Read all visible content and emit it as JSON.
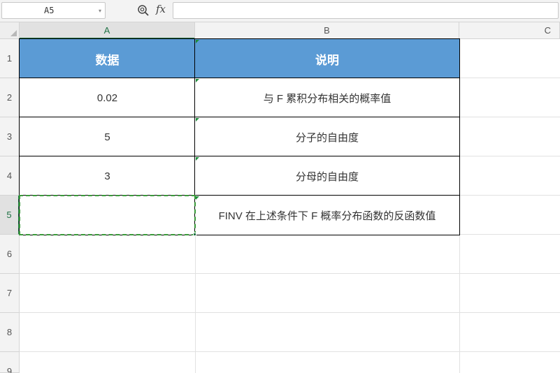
{
  "formula_bar": {
    "name_box_value": "A5",
    "fx_label": "fx",
    "formula_value": ""
  },
  "columns": [
    "A",
    "B",
    "C"
  ],
  "rows": [
    "1",
    "2",
    "3",
    "4",
    "5",
    "6",
    "7",
    "8",
    "9"
  ],
  "table": {
    "header": {
      "a": "数据",
      "b": "说明"
    },
    "rows": [
      {
        "a": "0.02",
        "b": "与 F 累积分布相关的概率值"
      },
      {
        "a": "5",
        "b": "分子的自由度"
      },
      {
        "a": "3",
        "b": "分母的自由度"
      },
      {
        "a": "",
        "b": "FINV 在上述条件下 F 概率分布函数的反函数值"
      }
    ]
  },
  "colors": {
    "header_fill": "#5b9bd5",
    "selection_green": "#217346"
  }
}
